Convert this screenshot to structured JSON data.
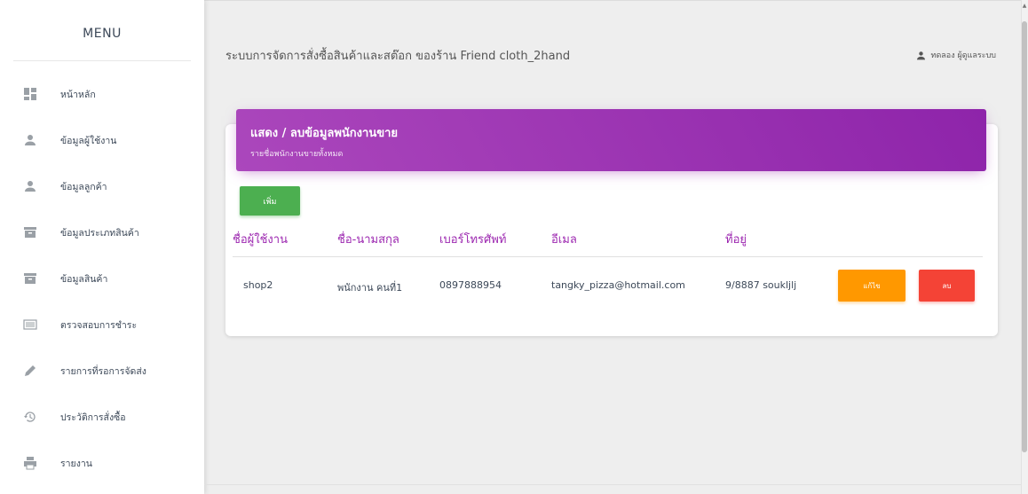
{
  "sidebar": {
    "title": "MENU",
    "items": [
      {
        "label": "หน้าหลัก",
        "icon": "dashboard-icon"
      },
      {
        "label": "ข้อมูลผู้ใช้งาน",
        "icon": "person-icon"
      },
      {
        "label": "ข้อมูลลูกค้า",
        "icon": "person-icon"
      },
      {
        "label": "ข้อมูลประเภทสินค้า",
        "icon": "archive-icon"
      },
      {
        "label": "ข้อมูลสินค้า",
        "icon": "archive-icon"
      },
      {
        "label": "ตรวจสอบการชำระ",
        "icon": "barcode-icon"
      },
      {
        "label": "รายการที่รอการจัดส่ง",
        "icon": "pencil-icon"
      },
      {
        "label": "ประวัติการสั่งซื้อ",
        "icon": "history-icon"
      },
      {
        "label": "รายงาน",
        "icon": "print-icon"
      }
    ]
  },
  "header": {
    "title_prefix": "ระบบการจัดการสั่งซื้อสินค้าและสต๊อก ของร้าน",
    "store_name": "Friend cloth_2hand",
    "user_label": "ทดลอง ผู้ดูแลระบบ"
  },
  "card": {
    "title": "แสดง / ลบข้อมูลพนักงานขาย",
    "subtitle": "รายชื่อพนักงานขายทั้งหมด",
    "add_label": "เพิ่ม",
    "columns": [
      "ชื่อผู้ใช้งาน",
      "ชื่อ-นามสกุล",
      "เบอร์โทรศัพท์",
      "อีเมล",
      "ที่อยู่"
    ],
    "rows": [
      {
        "username": "shop2",
        "fullname": "พนักงาน คนที่1",
        "phone": "0897888954",
        "email": "tangky_pizza@hotmail.com",
        "address": "9/8887 soukljlj",
        "edit_label": "แก้ไข",
        "delete_label": "ลบ"
      }
    ]
  },
  "colors": {
    "header_gradient_start": "#ab47bc",
    "header_gradient_end": "#8e24aa",
    "add_button": "#4caf50",
    "edit_button": "#ff9800",
    "delete_button": "#f44336",
    "column_header": "#9c27b0"
  }
}
